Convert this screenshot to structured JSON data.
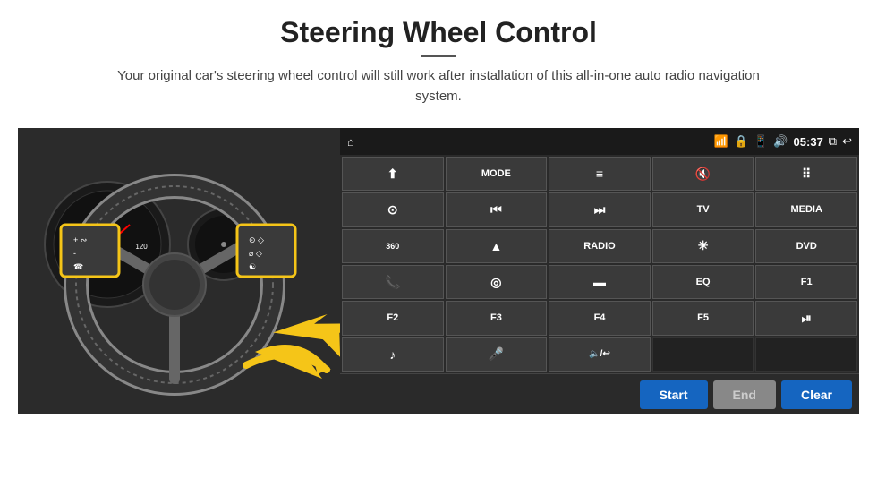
{
  "page": {
    "title": "Steering Wheel Control",
    "subtitle": "Your original car's steering wheel control will still work after installation of this all-in-one auto radio navigation system."
  },
  "statusBar": {
    "time": "05:37",
    "icons": [
      "home",
      "wifi",
      "lock",
      "sim",
      "bluetooth",
      "window",
      "back"
    ]
  },
  "buttons": [
    {
      "id": "r1c1",
      "icon": "⬆",
      "type": "icon"
    },
    {
      "id": "r1c2",
      "label": "MODE",
      "type": "text"
    },
    {
      "id": "r1c3",
      "icon": "≡",
      "type": "icon"
    },
    {
      "id": "r1c4",
      "icon": "🔇",
      "type": "icon"
    },
    {
      "id": "r1c5",
      "icon": "⋯",
      "type": "icon"
    },
    {
      "id": "r2c1",
      "icon": "⊙",
      "type": "icon"
    },
    {
      "id": "r2c2",
      "icon": "⏮",
      "type": "icon"
    },
    {
      "id": "r2c3",
      "icon": "⏭",
      "type": "icon"
    },
    {
      "id": "r2c4",
      "label": "TV",
      "type": "text"
    },
    {
      "id": "r2c5",
      "label": "MEDIA",
      "type": "text"
    },
    {
      "id": "r3c1",
      "icon": "360",
      "type": "text-sm"
    },
    {
      "id": "r3c2",
      "icon": "▲",
      "type": "icon"
    },
    {
      "id": "r3c3",
      "label": "RADIO",
      "type": "text"
    },
    {
      "id": "r3c4",
      "icon": "☀",
      "type": "icon"
    },
    {
      "id": "r3c5",
      "label": "DVD",
      "type": "text"
    },
    {
      "id": "r4c1",
      "icon": "📞",
      "type": "icon"
    },
    {
      "id": "r4c2",
      "icon": "◎",
      "type": "icon"
    },
    {
      "id": "r4c3",
      "icon": "▬",
      "type": "icon"
    },
    {
      "id": "r4c4",
      "label": "EQ",
      "type": "text"
    },
    {
      "id": "r4c5",
      "label": "F1",
      "type": "text"
    },
    {
      "id": "r5c1",
      "label": "F2",
      "type": "text"
    },
    {
      "id": "r5c2",
      "label": "F3",
      "type": "text"
    },
    {
      "id": "r5c3",
      "label": "F4",
      "type": "text"
    },
    {
      "id": "r5c4",
      "label": "F5",
      "type": "text"
    },
    {
      "id": "r5c5",
      "icon": "⏯",
      "type": "icon"
    },
    {
      "id": "r6c1",
      "icon": "♪",
      "type": "icon"
    },
    {
      "id": "r6c2",
      "icon": "🎤",
      "type": "icon"
    },
    {
      "id": "r6c3",
      "icon": "🔈/↩",
      "type": "text-sm"
    }
  ],
  "bottomBar": {
    "startLabel": "Start",
    "endLabel": "End",
    "clearLabel": "Clear"
  }
}
